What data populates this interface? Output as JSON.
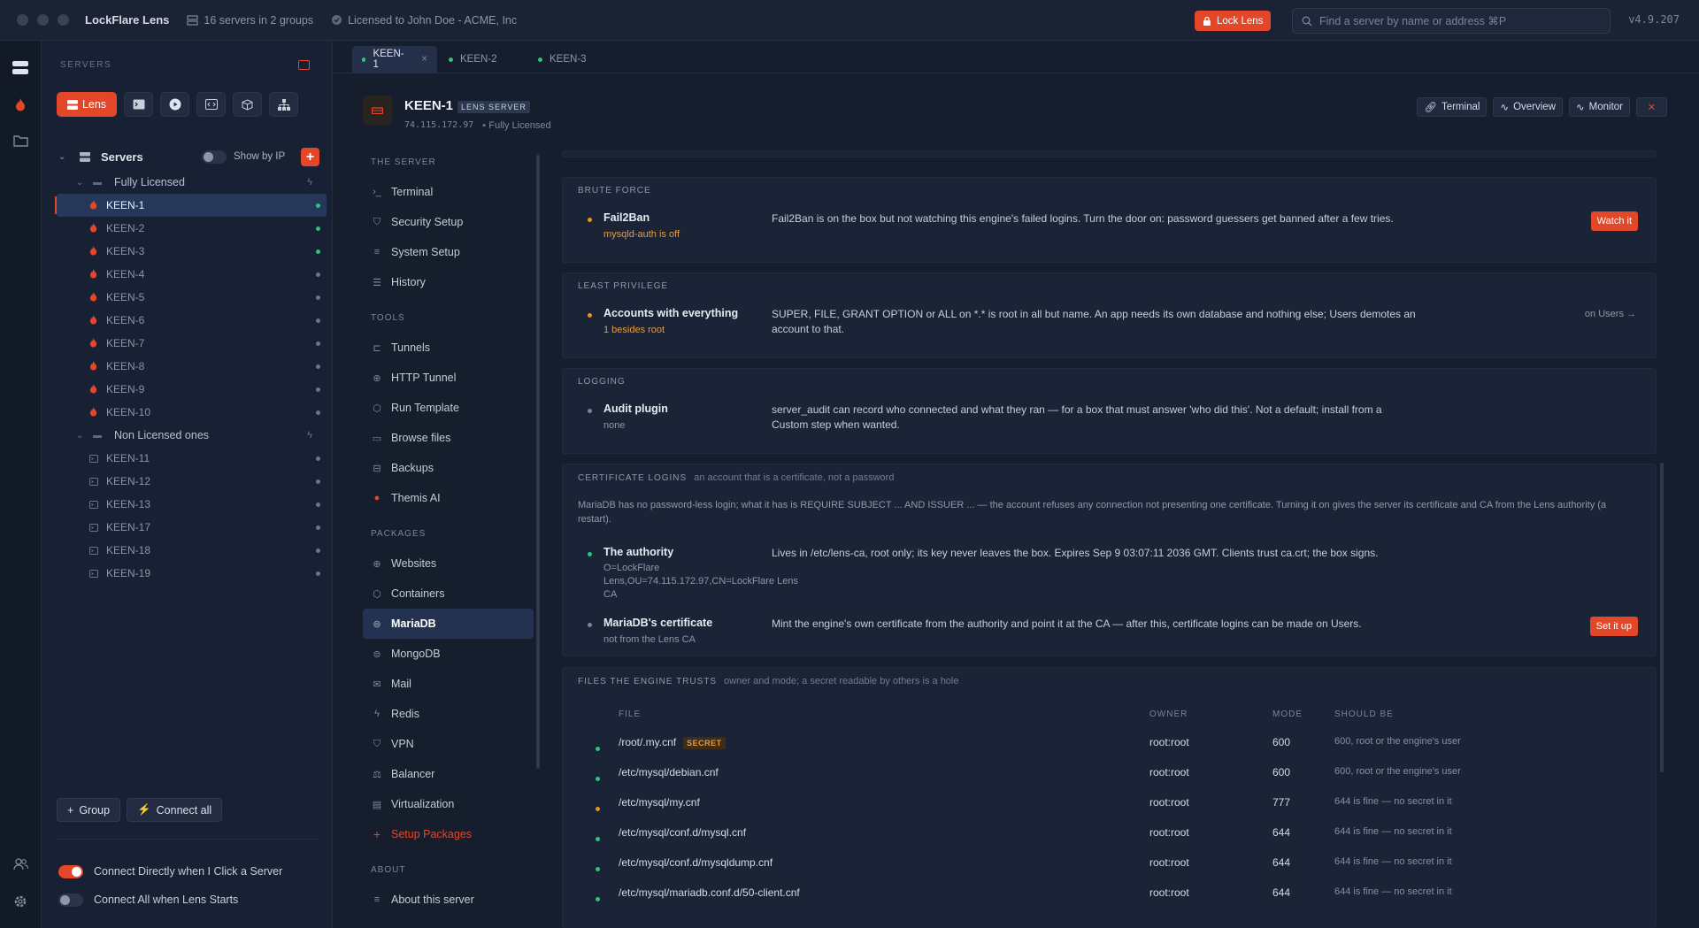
{
  "app": {
    "title": "LockFlare Lens",
    "servers_summary": "16 servers in 2 groups",
    "license": "Licensed to John Doe - ACME, Inc",
    "lock_label": "Lock Lens",
    "search_placeholder": "Find a server by name or address  ⌘P",
    "version": "v4.9.207"
  },
  "colors": {
    "accent": "#e2472a",
    "online": "#2ec27e",
    "warning": "#e2922a"
  },
  "sidebar": {
    "heading": "SERVERS",
    "lens_label": "Lens",
    "root_label": "Servers",
    "show_by_ip": "Show by IP",
    "groups": [
      {
        "label": "Fully Licensed",
        "servers": [
          {
            "name": "KEEN-1",
            "online": true
          },
          {
            "name": "KEEN-2",
            "online": true
          },
          {
            "name": "KEEN-3",
            "online": true
          },
          {
            "name": "KEEN-4",
            "online": false
          },
          {
            "name": "KEEN-5",
            "online": false
          },
          {
            "name": "KEEN-6",
            "online": false
          },
          {
            "name": "KEEN-7",
            "online": false
          },
          {
            "name": "KEEN-8",
            "online": false
          },
          {
            "name": "KEEN-9",
            "online": false
          },
          {
            "name": "KEEN-10",
            "online": false
          }
        ]
      },
      {
        "label": "Non Licensed ones",
        "servers": [
          {
            "name": "KEEN-11",
            "online": false
          },
          {
            "name": "KEEN-12",
            "online": false
          },
          {
            "name": "KEEN-13",
            "online": false
          },
          {
            "name": "KEEN-17",
            "online": false
          },
          {
            "name": "KEEN-18",
            "online": false
          },
          {
            "name": "KEEN-19",
            "online": false
          }
        ]
      }
    ],
    "group_btn": "Group",
    "connect_all_btn": "Connect all",
    "toggle_direct": "Connect Directly when I Click a Server",
    "toggle_all": "Connect All when Lens Starts"
  },
  "tabs": [
    "KEEN-1",
    "KEEN-2",
    "KEEN-3"
  ],
  "server": {
    "name": "KEEN-1",
    "badge": "LENS SERVER",
    "ip": "74.115.172.97",
    "license": "Fully Licensed"
  },
  "header_buttons": {
    "terminal": "Terminal",
    "overview": "Overview",
    "monitor": "Monitor"
  },
  "subnav": {
    "sec_server": "THE SERVER",
    "server_items": [
      "Terminal",
      "Security Setup",
      "System Setup",
      "History"
    ],
    "sec_tools": "TOOLS",
    "tool_items": [
      "Tunnels",
      "HTTP Tunnel",
      "Run Template",
      "Browse files",
      "Backups",
      "Themis AI"
    ],
    "sec_packages": "PACKAGES",
    "package_items": [
      "Websites",
      "Containers",
      "MariaDB",
      "MongoDB",
      "Mail",
      "Redis",
      "VPN",
      "Balancer",
      "Virtualization"
    ],
    "setup_packages": "Setup Packages",
    "sec_about": "ABOUT",
    "about_items": [
      "About this server"
    ]
  },
  "brute_force": {
    "heading": "BRUTE FORCE",
    "title": "Fail2Ban",
    "sub": "mysqld-auth is off",
    "desc": "Fail2Ban is on the box but not watching this engine's failed logins. Turn the door on: password guessers get banned after a few tries.",
    "action": "Watch it"
  },
  "least_privilege": {
    "heading": "LEAST PRIVILEGE",
    "title": "Accounts with everything",
    "sub": "1 besides root",
    "desc": "SUPER, FILE, GRANT OPTION or ALL on *.* is root in all but name. An app needs its own database and nothing else; Users demotes an account to that.",
    "link": "on Users →"
  },
  "logging": {
    "heading": "LOGGING",
    "title": "Audit plugin",
    "sub": "none",
    "desc": "server_audit can record who connected and what they ran — for a box that must answer 'who did this'. Not a default; install from a Custom step when wanted."
  },
  "cert_logins": {
    "heading": "CERTIFICATE LOGINS",
    "note": "an account that is a certificate, not a password",
    "intro": "MariaDB has no password-less login; what it has is REQUIRE SUBJECT ... AND ISSUER ... — the account refuses any connection not presenting one certificate. Turning it on gives the server its certificate and CA from the Lens authority (a restart).",
    "authority_title": "The authority",
    "authority_sub": "O=LockFlare Lens,OU=74.115.172.97,CN=LockFlare Lens CA",
    "authority_desc": "Lives in /etc/lens-ca, root only; its key never leaves the box. Expires Sep 9 03:07:11 2036 GMT. Clients trust ca.crt; the box signs.",
    "cert_title": "MariaDB's certificate",
    "cert_sub": "not from the Lens CA",
    "cert_desc": "Mint the engine's own certificate from the authority and point it at the CA — after this, certificate logins can be made on Users.",
    "cert_action": "Set it up"
  },
  "files": {
    "heading": "FILES THE ENGINE TRUSTS",
    "note": "owner and mode; a secret readable by others is a hole",
    "columns": {
      "file": "FILE",
      "owner": "OWNER",
      "mode": "MODE",
      "should": "SHOULD BE"
    },
    "secret_badge": "SECRET",
    "rows": [
      {
        "file": "/root/.my.cnf",
        "owner": "root:root",
        "mode": "600",
        "should": "600, root or the engine's user",
        "status": "ok"
      },
      {
        "file": "/etc/mysql/debian.cnf",
        "owner": "root:root",
        "mode": "600",
        "should": "600, root or the engine's user",
        "status": "ok"
      },
      {
        "file": "/etc/mysql/my.cnf",
        "owner": "root:root",
        "mode": "777",
        "should": "644 is fine — no secret in it",
        "status": "warn"
      },
      {
        "file": "/etc/mysql/conf.d/mysql.cnf",
        "owner": "root:root",
        "mode": "644",
        "should": "644 is fine — no secret in it",
        "status": "ok"
      },
      {
        "file": "/etc/mysql/conf.d/mysqldump.cnf",
        "owner": "root:root",
        "mode": "644",
        "should": "644 is fine — no secret in it",
        "status": "ok"
      },
      {
        "file": "/etc/mysql/mariadb.conf.d/50-client.cnf",
        "owner": "root:root",
        "mode": "644",
        "should": "644 is fine — no secret in it",
        "status": "ok"
      }
    ]
  }
}
